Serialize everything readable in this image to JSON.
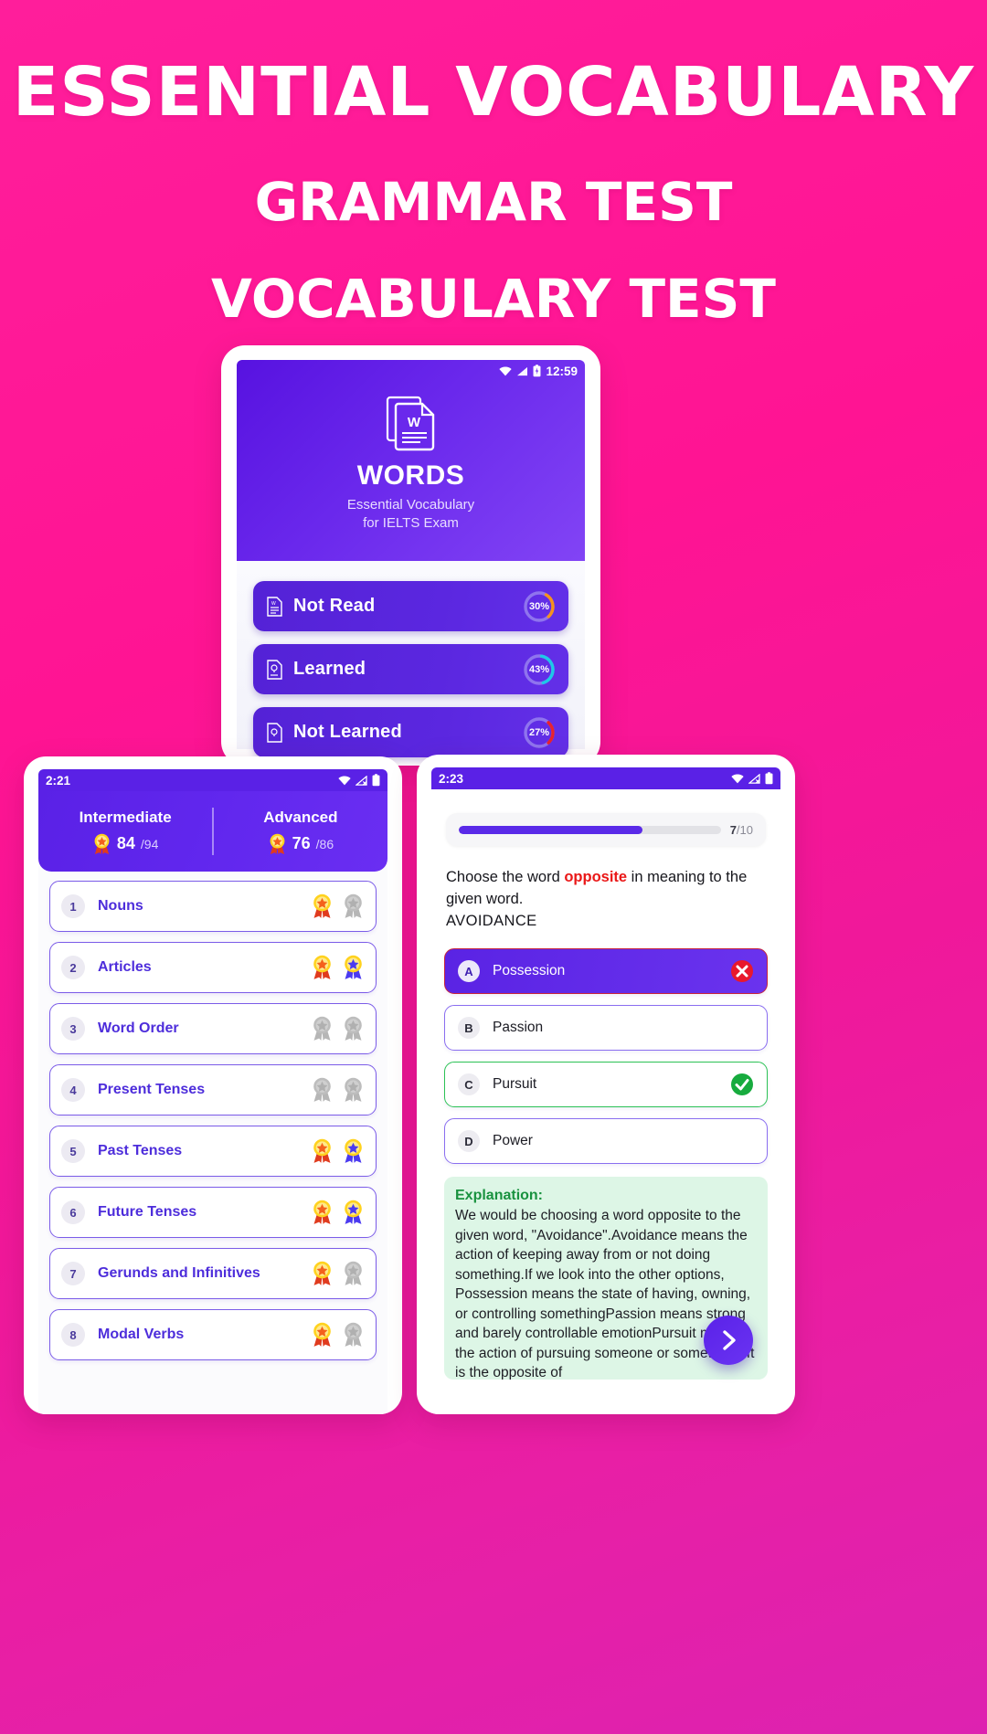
{
  "promo": {
    "headline_1": "ESSENTIAL  VOCABULARY",
    "headline_2": "GRAMMAR TEST",
    "headline_3": "VOCABULARY TEST",
    "background_color": "#ff1493"
  },
  "phone_home": {
    "status": {
      "time": "12:59",
      "wifi_icon": "wifi-icon",
      "signal_icon": "signal-icon",
      "battery_icon": "battery-icon"
    },
    "app": {
      "icon": "word-document-icon",
      "title": "WORDS",
      "subtitle_line1": "Essential Vocabulary",
      "subtitle_line2": "for IELTS Exam",
      "header_color": "#6a28ec"
    },
    "stats": [
      {
        "icon": "doc-word-icon",
        "label": "Not Read",
        "percent": "30%",
        "value": 30,
        "ring_color": "#f5921e"
      },
      {
        "icon": "doc-bulb-icon",
        "label": "Learned",
        "percent": "43%",
        "value": 43,
        "ring_color": "#1ec8e8"
      },
      {
        "icon": "doc-bulb-off-icon",
        "label": "Not Learned",
        "percent": "27%",
        "value": 27,
        "ring_color": "#e8232e"
      }
    ]
  },
  "phone_topics": {
    "status": {
      "time": "2:21",
      "wifi_icon": "wifi-icon",
      "signal_icon": "signal-off-icon",
      "battery_icon": "battery-icon"
    },
    "levels": [
      {
        "name": "Intermediate",
        "medal_icon": "medal-gold-icon",
        "score": "84",
        "total": "/94"
      },
      {
        "name": "Advanced",
        "medal_icon": "medal-gold-icon",
        "score": "76",
        "total": "/86"
      }
    ],
    "topics": [
      {
        "num": "1",
        "label": "Nouns",
        "badge_1": "gold",
        "badge_2": "grey"
      },
      {
        "num": "2",
        "label": "Articles",
        "badge_1": "gold",
        "badge_2": "blue"
      },
      {
        "num": "3",
        "label": "Word Order",
        "badge_1": "grey",
        "badge_2": "grey"
      },
      {
        "num": "4",
        "label": "Present Tenses",
        "badge_1": "grey",
        "badge_2": "grey"
      },
      {
        "num": "5",
        "label": "Past Tenses",
        "badge_1": "gold",
        "badge_2": "blue"
      },
      {
        "num": "6",
        "label": "Future Tenses",
        "badge_1": "gold",
        "badge_2": "blue"
      },
      {
        "num": "7",
        "label": "Gerunds and Infinitives",
        "badge_1": "gold",
        "badge_2": "grey"
      },
      {
        "num": "8",
        "label": "Modal Verbs",
        "badge_1": "gold",
        "badge_2": "grey"
      }
    ]
  },
  "phone_quiz": {
    "status": {
      "time": "2:23",
      "wifi_icon": "wifi-icon",
      "signal_icon": "signal-off-icon",
      "battery_icon": "battery-icon"
    },
    "progress": {
      "current": "7",
      "total": "/10",
      "percent": 70
    },
    "question": {
      "prefix": "Choose the word ",
      "highlight": "opposite",
      "suffix": " in meaning to the given word.",
      "word": "AVOIDANCE"
    },
    "options": [
      {
        "key": "A",
        "text": "Possession",
        "state": "selected-wrong",
        "mark": "cross-icon"
      },
      {
        "key": "B",
        "text": "Passion",
        "state": "neutral",
        "mark": ""
      },
      {
        "key": "C",
        "text": "Pursuit",
        "state": "correct",
        "mark": "check-icon"
      },
      {
        "key": "D",
        "text": "Power",
        "state": "neutral",
        "mark": ""
      }
    ],
    "explanation": {
      "heading": "Explanation:",
      "body": "We would be choosing a word opposite to the given word, \"Avoidance\".Avoidance means the action of keeping away from or not doing something.If we look into the other options, Possession means the state of having, owning, or controlling somethingPassion means strong and barely controllable emotionPursuit means the action of pursuing someone or something. It is the opposite of"
    },
    "next_button": "chevron-right-icon"
  }
}
